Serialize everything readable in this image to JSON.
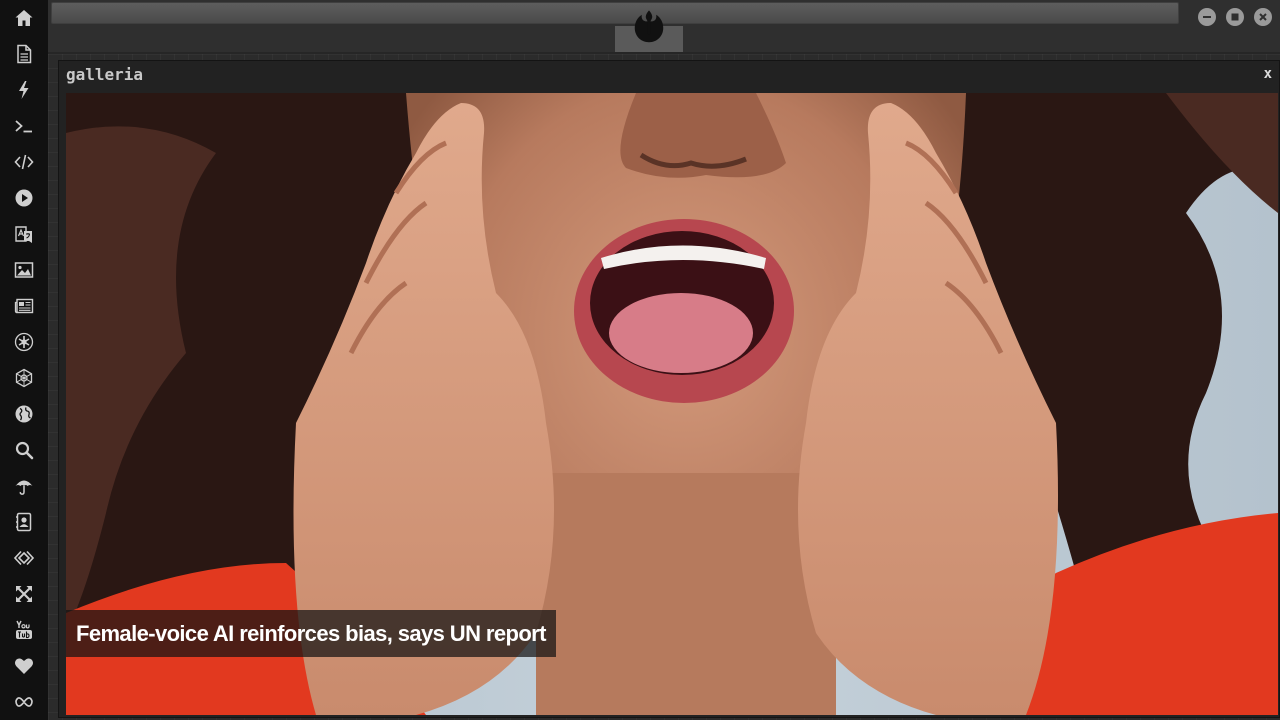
{
  "sidebar": {
    "icons": [
      "home-icon",
      "document-icon",
      "lightning-icon",
      "terminal-icon",
      "code-icon",
      "play-icon",
      "translate-icon",
      "image-icon",
      "newspaper-icon",
      "rebel-alliance-icon",
      "galactic-empire-icon",
      "globe-icon",
      "search-icon",
      "umbrella-icon",
      "contacts-icon",
      "api-icon",
      "expand-icon",
      "youtube-icon",
      "heart-icon",
      "infinity-icon"
    ]
  },
  "topbar": {
    "logo_icon": "rebel-alliance-icon",
    "window_controls": [
      "minimize-icon",
      "maximize-icon",
      "close-icon"
    ]
  },
  "window": {
    "title": "galleria",
    "close_label": "x"
  },
  "gallery": {
    "image_subject": "woman-shouting-with-hands-around-mouth",
    "caption": "Female-voice AI reinforces bias, says UN report"
  },
  "colors": {
    "sidebar_bg": "#111111",
    "topbar_bg": "#2f2f2f",
    "window_bg": "#222222",
    "icon_color": "#cfcfcf"
  }
}
